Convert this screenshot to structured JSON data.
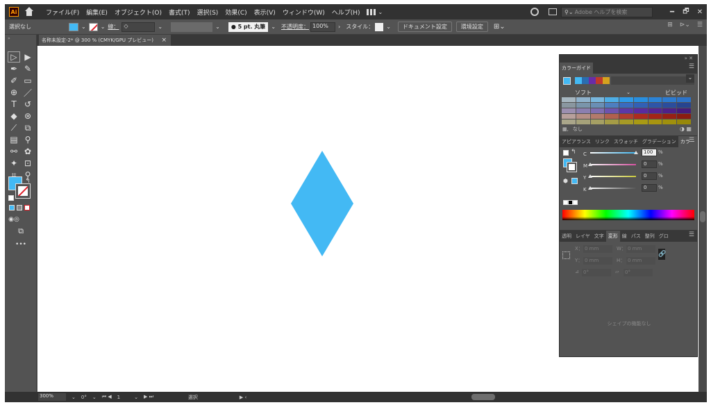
{
  "app": {
    "logo": "Ai",
    "menu": [
      "ファイル(F)",
      "編集(E)",
      "オブジェクト(O)",
      "書式(T)",
      "選択(S)",
      "効果(C)",
      "表示(V)",
      "ウィンドウ(W)",
      "ヘルプ(H)"
    ],
    "search_placeholder": "Adobe ヘルプを検索",
    "win_controls": [
      "━",
      "🗗",
      "✕"
    ]
  },
  "control_bar": {
    "selection_status": "選択なし",
    "stroke_label": "線：",
    "stroke_spin": "◇",
    "stroke_profile": "● 5 pt. 丸筆",
    "opacity_label": "不透明度：",
    "opacity_value": "100%",
    "style_label": "スタイル：",
    "doc_setup_button": "ドキュメント設定",
    "preferences_button": "環境設定"
  },
  "document_tab": {
    "title": "名称未設定-2* @ 300 % (CMYK/GPU プレビュー)",
    "close": "×"
  },
  "colors": {
    "fill": "#43b9f4",
    "diamond": "#43b9f4"
  },
  "status_bar": {
    "zoom": "300%",
    "rotation": "0°",
    "artboard": "1",
    "mode": "選択"
  },
  "color_guide": {
    "tab_label": "カラーガイド",
    "left_label": "ソフト",
    "right_label": "ビビッド",
    "none_label": "なし",
    "harmony_swatches": [
      "#43b9f4",
      "#2a6db0",
      "#6a2ca8",
      "#c0392b",
      "#d5a21f"
    ],
    "grid": [
      [
        "#a6b6c0",
        "#8fb2cc",
        "#79b7dd",
        "#4eaee6",
        "#2f9be8",
        "#288fe0",
        "#2b83d6",
        "#2c7bd0",
        "#2c73c8"
      ],
      [
        "#8a97a0",
        "#7a95ab",
        "#6a8fb5",
        "#4d7fc0",
        "#3a6bbf",
        "#3260b5",
        "#2e55a8",
        "#2b4d9c",
        "#27448f"
      ],
      [
        "#9c8fb0",
        "#8b7fb0",
        "#7f6db0",
        "#6d53ae",
        "#5c38a6",
        "#5a2b9f",
        "#562494",
        "#4e2188",
        "#461c7c"
      ],
      [
        "#b8a09c",
        "#b58f86",
        "#b27a6c",
        "#b0604f",
        "#b03d2d",
        "#ad2b1f",
        "#a42418",
        "#982014",
        "#8b1c10"
      ],
      [
        "#aaa68a",
        "#a6a27a",
        "#a59f64",
        "#a59c46",
        "#a69a26",
        "#a99a14",
        "#a89510",
        "#a0900d",
        "#97880a"
      ]
    ]
  },
  "color_panel": {
    "tabs": [
      "アピアランス",
      "リンク",
      "スウォッチ",
      "グラデーション",
      "カラー"
    ],
    "channels": [
      {
        "label": "C",
        "value": "100",
        "fill": 1.0,
        "color": "#3ab4ef"
      },
      {
        "label": "M",
        "value": "0",
        "fill": 0.0,
        "color": "#d64fa0"
      },
      {
        "label": "Y",
        "value": "0",
        "fill": 0.0,
        "color": "#c8c83a"
      },
      {
        "label": "K",
        "value": "0",
        "fill": 0.0,
        "color": "#555555"
      }
    ],
    "unit": "%"
  },
  "transform_panel": {
    "tabs": [
      "透明",
      "レイヤ",
      "文字",
      "変形",
      "線",
      "パス",
      "整列",
      "グロ"
    ],
    "x_label": "X：",
    "y_label": "Y：",
    "w_label": "W：",
    "h_label": "H：",
    "x_value": "0 mm",
    "y_value": "0 mm",
    "w_value": "0 mm",
    "h_value": "0 mm",
    "angle_value": "0°",
    "shear_value": "0°",
    "empty_message": "シェイプの機能なし"
  }
}
